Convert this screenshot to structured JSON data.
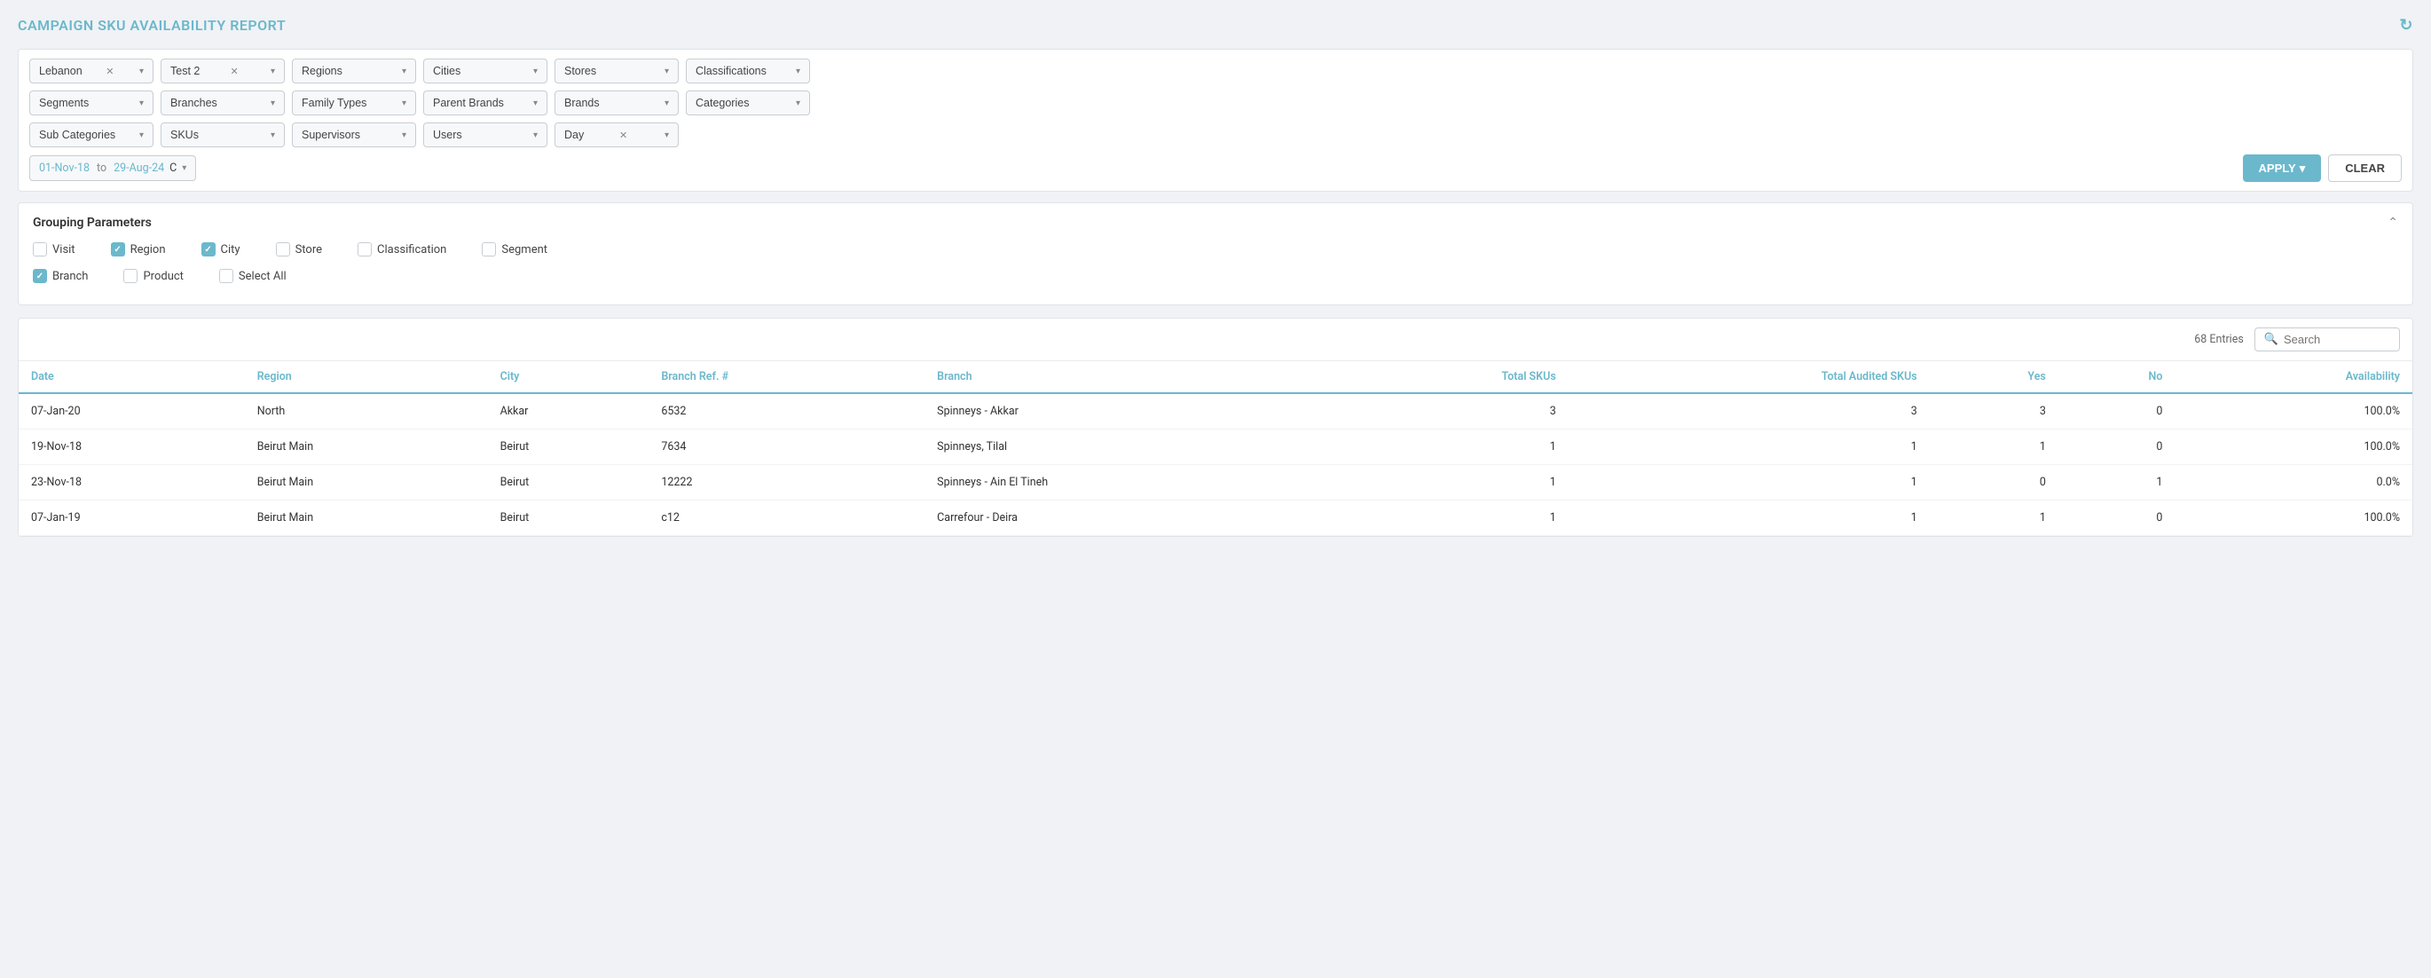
{
  "page": {
    "title": "CAMPAIGN SKU AVAILABILITY REPORT"
  },
  "filters": {
    "row1": [
      {
        "id": "lebanon",
        "label": "Lebanon",
        "hasValue": true,
        "showClear": true
      },
      {
        "id": "test2",
        "label": "Test 2",
        "hasValue": true,
        "showClear": true
      },
      {
        "id": "regions",
        "label": "Regions",
        "hasValue": false
      },
      {
        "id": "cities",
        "label": "Cities",
        "hasValue": false
      },
      {
        "id": "stores",
        "label": "Stores",
        "hasValue": false
      },
      {
        "id": "classifications",
        "label": "Classifications",
        "hasValue": false
      }
    ],
    "row2": [
      {
        "id": "segments",
        "label": "Segments",
        "hasValue": false
      },
      {
        "id": "branches",
        "label": "Branches",
        "hasValue": false
      },
      {
        "id": "family-types",
        "label": "Family Types",
        "hasValue": false
      },
      {
        "id": "parent-brands",
        "label": "Parent Brands",
        "hasValue": false
      },
      {
        "id": "brands",
        "label": "Brands",
        "hasValue": false
      },
      {
        "id": "categories",
        "label": "Categories",
        "hasValue": false
      }
    ],
    "row3": [
      {
        "id": "sub-categories",
        "label": "Sub Categories",
        "hasValue": false
      },
      {
        "id": "skus",
        "label": "SKUs",
        "hasValue": false
      },
      {
        "id": "supervisors",
        "label": "Supervisors",
        "hasValue": false
      },
      {
        "id": "users",
        "label": "Users",
        "hasValue": false
      },
      {
        "id": "day",
        "label": "Day",
        "hasValue": true,
        "showClear": true
      }
    ],
    "dateFrom": "01-Nov-18",
    "dateTo": "29-Aug-24",
    "dateMode": "C",
    "applyLabel": "APPLY",
    "clearLabel": "CLEAR"
  },
  "grouping": {
    "title": "Grouping Parameters",
    "params": [
      {
        "id": "visit",
        "label": "Visit",
        "checked": false
      },
      {
        "id": "region",
        "label": "Region",
        "checked": true
      },
      {
        "id": "city",
        "label": "City",
        "checked": true
      },
      {
        "id": "store",
        "label": "Store",
        "checked": false
      },
      {
        "id": "classification",
        "label": "Classification",
        "checked": false
      },
      {
        "id": "segment",
        "label": "Segment",
        "checked": false
      },
      {
        "id": "branch",
        "label": "Branch",
        "checked": true
      },
      {
        "id": "product",
        "label": "Product",
        "checked": false
      },
      {
        "id": "select-all",
        "label": "Select All",
        "checked": false
      }
    ]
  },
  "table": {
    "entries": "68 Entries",
    "search_placeholder": "Search",
    "columns": [
      "Date",
      "Region",
      "City",
      "Branch Ref. #",
      "Branch",
      "Total SKUs",
      "Total Audited SKUs",
      "Yes",
      "No",
      "Availability"
    ],
    "rows": [
      {
        "date": "07-Jan-20",
        "region": "North",
        "city": "Akkar",
        "branch_ref": "6532",
        "branch": "Spinneys - Akkar",
        "total_skus": "3",
        "total_audited": "3",
        "yes": "3",
        "no": "0",
        "availability": "100.0%"
      },
      {
        "date": "19-Nov-18",
        "region": "Beirut Main",
        "city": "Beirut",
        "branch_ref": "7634",
        "branch": "Spinneys, Tilal",
        "total_skus": "1",
        "total_audited": "1",
        "yes": "1",
        "no": "0",
        "availability": "100.0%"
      },
      {
        "date": "23-Nov-18",
        "region": "Beirut Main",
        "city": "Beirut",
        "branch_ref": "12222",
        "branch": "Spinneys - Ain El Tineh",
        "total_skus": "1",
        "total_audited": "1",
        "yes": "0",
        "no": "1",
        "availability": "0.0%"
      },
      {
        "date": "07-Jan-19",
        "region": "Beirut Main",
        "city": "Beirut",
        "branch_ref": "c12",
        "branch": "Carrefour - Deira",
        "total_skus": "1",
        "total_audited": "1",
        "yes": "1",
        "no": "0",
        "availability": "100.0%"
      }
    ]
  }
}
